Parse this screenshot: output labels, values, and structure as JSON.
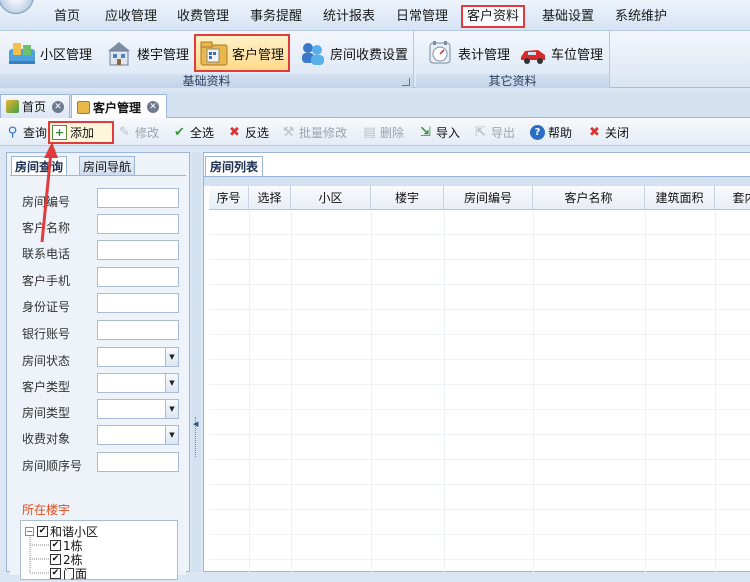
{
  "menu": {
    "items": [
      "首页",
      "应收管理",
      "收费管理",
      "事务提醒",
      "统计报表",
      "日常管理",
      "客户资料",
      "基础设置",
      "系统维护"
    ],
    "active": "客户资料"
  },
  "ribbon": {
    "groups": [
      {
        "caption": "基础资料",
        "buttons": [
          {
            "label": "小区管理",
            "icon": "community-icon"
          },
          {
            "label": "楼宇管理",
            "icon": "building-icon"
          },
          {
            "label": "客户管理",
            "icon": "customer-folder-icon"
          },
          {
            "label": "房间收费设置",
            "icon": "room-fee-icon"
          }
        ]
      },
      {
        "caption": "其它资料",
        "buttons": [
          {
            "label": "表计管理",
            "icon": "meter-icon"
          },
          {
            "label": "车位管理",
            "icon": "car-icon"
          }
        ]
      }
    ],
    "active_button": "客户管理"
  },
  "doc_tabs": [
    {
      "label": "首页",
      "selected": false
    },
    {
      "label": "客户管理",
      "selected": true
    }
  ],
  "toolbar": {
    "query": "查询",
    "add": "添加",
    "edit": "修改",
    "select_all": "全选",
    "invert": "反选",
    "batch_edit": "批量修改",
    "delete": "删除",
    "import": "导入",
    "export": "导出",
    "help": "帮助",
    "close": "关闭"
  },
  "left_panel": {
    "tabs": [
      "房间查询",
      "房间导航"
    ],
    "fields": [
      {
        "label": "房间编号",
        "type": "text",
        "value": ""
      },
      {
        "label": "客户名称",
        "type": "text",
        "value": ""
      },
      {
        "label": "联系电话",
        "type": "text",
        "value": ""
      },
      {
        "label": "客户手机",
        "type": "text",
        "value": ""
      },
      {
        "label": "身份证号",
        "type": "text",
        "value": ""
      },
      {
        "label": "银行账号",
        "type": "text",
        "value": ""
      },
      {
        "label": "房间状态",
        "type": "combo",
        "value": ""
      },
      {
        "label": "客户类型",
        "type": "combo",
        "value": ""
      },
      {
        "label": "房间类型",
        "type": "combo",
        "value": ""
      },
      {
        "label": "收费对象",
        "type": "combo",
        "value": ""
      },
      {
        "label": "房间顺序号",
        "type": "text",
        "value": ""
      }
    ],
    "building_label": "所在楼宇",
    "tree": {
      "root": "和谐小区",
      "children": [
        "1栋",
        "2栋",
        "门面"
      ]
    }
  },
  "right_panel": {
    "tab": "房间列表",
    "columns": [
      "序号",
      "选择",
      "小区",
      "楼宇",
      "房间编号",
      "客户名称",
      "建筑面积",
      "套内"
    ]
  },
  "colors": {
    "highlight_border": "#e23b3b",
    "accent_orange": "#e24b1a",
    "panel_bg": "#dbe6f4"
  }
}
